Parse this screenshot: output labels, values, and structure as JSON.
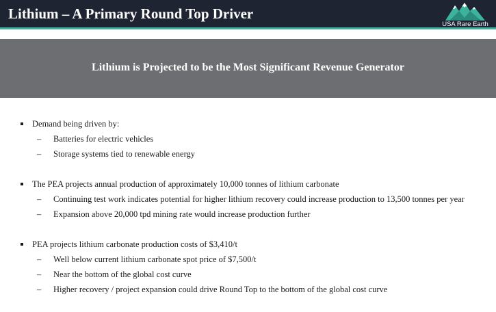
{
  "header": {
    "title": "Lithium – A Primary Round Top Driver",
    "logo_text": "USA Rare Earth",
    "accent_color": "#3db39e",
    "background_color": "#1f2433"
  },
  "banner": {
    "text": "Lithium is Projected to be the Most Significant Revenue Generator",
    "background_color": "#6d6e72"
  },
  "sections": [
    {
      "bullet": "Demand being driven by:",
      "subs": [
        "Batteries for electric vehicles",
        "Storage systems tied to renewable energy"
      ]
    },
    {
      "bullet": "The PEA projects annual production of approximately 10,000 tonnes of lithium carbonate",
      "subs": [
        "Continuing test work indicates potential for higher lithium recovery could increase production to 13,500 tonnes per year",
        "Expansion above 20,000 tpd mining rate would increase production further"
      ]
    },
    {
      "bullet": "PEA projects lithium carbonate production costs of $3,410/t",
      "subs": [
        "Well below current lithium carbonate spot price of $7,500/t",
        "Near the bottom of the global cost curve",
        "Higher recovery / project expansion could drive Round Top to the bottom of the global cost curve"
      ]
    }
  ],
  "icons": {
    "logo": "mountain-logo-icon",
    "bullet": "square-bullet-icon",
    "sub_bullet": "dash-icon"
  }
}
